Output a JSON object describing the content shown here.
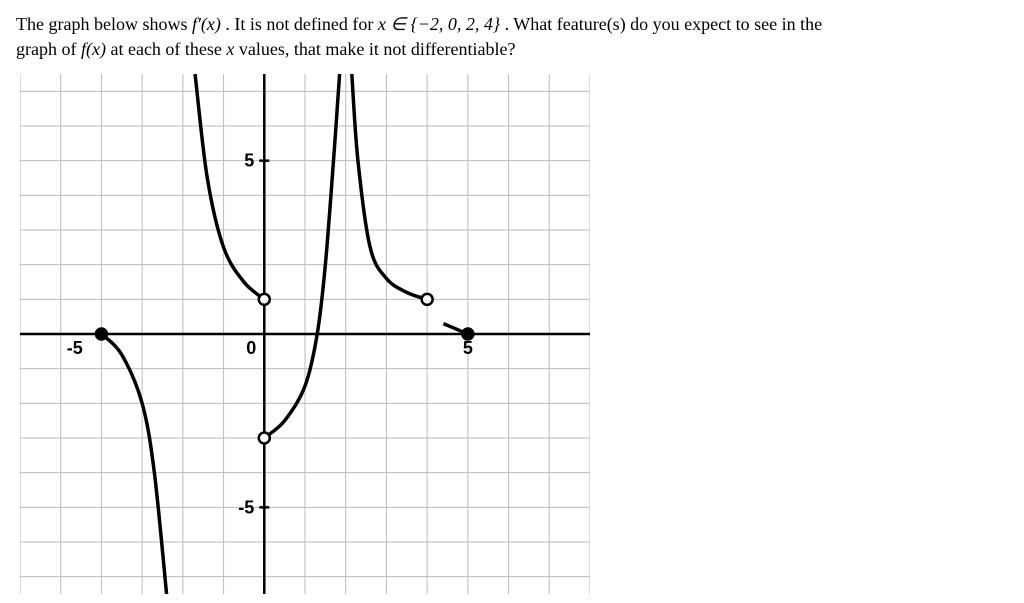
{
  "question": {
    "line1_pre": "The graph below shows ",
    "fprime": "f′(x)",
    "line1_mid": ". It is not defined for ",
    "xset": "x ∈ {−2, 0, 2, 4}",
    "line1_post": ". What feature(s) do you expect to see in the",
    "line2_pre": "graph of ",
    "fx": "f(x)",
    "line2_mid": " at each of these ",
    "xvar": "x",
    "line2_post": " values, that make it not differentiable?"
  },
  "chart_data": {
    "type": "line",
    "title": "",
    "xlabel": "",
    "ylabel": "",
    "xlim": [
      -6,
      8
    ],
    "ylim": [
      -7.5,
      7.5
    ],
    "xticks": [
      -5,
      0,
      5
    ],
    "yticks": [
      -5,
      0,
      5
    ],
    "grid": true,
    "curves": [
      {
        "name": "branch left of x=-2",
        "description": "f'(x) for x < -2; approaches -infinity as x→-2-",
        "points": [
          [
            -4,
            0
          ],
          [
            -3.5,
            -0.6
          ],
          [
            -3,
            -2
          ],
          [
            -2.7,
            -4
          ],
          [
            -2.4,
            -7.5
          ]
        ]
      },
      {
        "name": "branch between x=-2 and x=0",
        "description": "f'(x) for -2 < x < 0; comes down from +infinity, open circle at (0,1)",
        "points": [
          [
            -1.7,
            7.5
          ],
          [
            -1.4,
            4.5
          ],
          [
            -1,
            2.5
          ],
          [
            -0.5,
            1.5
          ],
          [
            0,
            1
          ]
        ]
      },
      {
        "name": "branch between x=0 and x=2",
        "description": "f'(x) for 0 < x < 2; open circle at (0,-3), curve rises toward +infinity as x→2-",
        "points": [
          [
            0,
            -3
          ],
          [
            0.5,
            -2.5
          ],
          [
            1,
            -1.5
          ],
          [
            1.3,
            0
          ],
          [
            1.5,
            2
          ],
          [
            1.7,
            5
          ],
          [
            1.85,
            7.5
          ]
        ]
      },
      {
        "name": "branch between x=2 and x=4",
        "description": "f'(x) for 2 < x < 4; comes down from +infinity, open circle at (4,1)",
        "points": [
          [
            2.15,
            7.5
          ],
          [
            2.3,
            5
          ],
          [
            2.6,
            2.5
          ],
          [
            3,
            1.6
          ],
          [
            3.5,
            1.2
          ],
          [
            4,
            1
          ]
        ]
      },
      {
        "name": "branch right of x=4",
        "description": "f'(x) for x > 4; closed point at (5,0), segment extends slightly left toward x=4",
        "points": [
          [
            4.4,
            0.3
          ],
          [
            5,
            0
          ]
        ]
      }
    ],
    "markers": [
      {
        "x": -4,
        "y": 0,
        "type": "closed"
      },
      {
        "x": 0,
        "y": 1,
        "type": "open"
      },
      {
        "x": 0,
        "y": -3,
        "type": "open"
      },
      {
        "x": 4,
        "y": 1,
        "type": "open"
      },
      {
        "x": 5,
        "y": 0,
        "type": "closed"
      }
    ],
    "undefined_at_x": [
      -2,
      0,
      2,
      4
    ]
  }
}
